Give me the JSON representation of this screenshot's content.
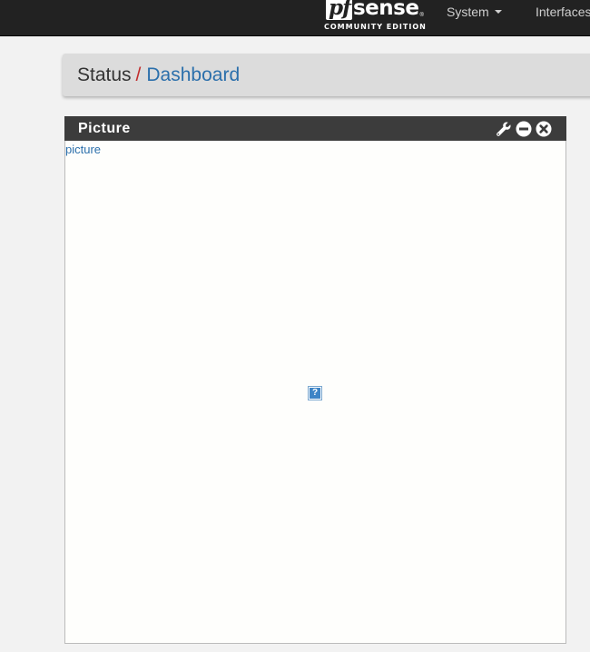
{
  "navbar": {
    "logo": {
      "pf": "pf",
      "sense": "sense",
      "registered": "®",
      "edition": "COMMUNITY EDITION"
    },
    "menu": [
      {
        "label": "System",
        "has_dropdown": true
      },
      {
        "label": "Interfaces"
      }
    ]
  },
  "breadcrumb": {
    "parent": "Status",
    "separator": "/",
    "current": "Dashboard"
  },
  "widget": {
    "title": "Picture",
    "controls": [
      "wrench-icon",
      "minimize-icon",
      "close-icon"
    ],
    "link_text": "picture",
    "image_placeholder": "?"
  },
  "colors": {
    "navbar_bg": "#222222",
    "panel_heading_bg": "#3c3c3c",
    "link": "#2b6fab",
    "separator": "#c12c2c",
    "breadcrumb_bg": "#dcdcdc"
  }
}
